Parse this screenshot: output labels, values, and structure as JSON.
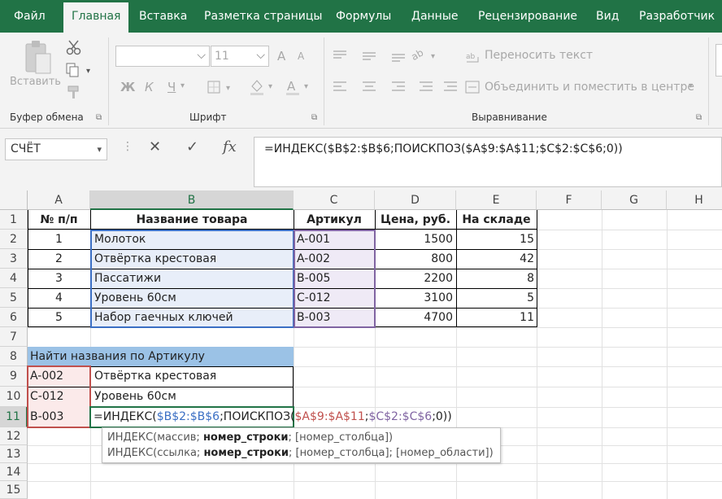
{
  "ribbon_tabs": [
    "Файл",
    "Главная",
    "Вставка",
    "Разметка страницы",
    "Формулы",
    "Данные",
    "Рецензирование",
    "Вид",
    "Разработчик"
  ],
  "active_tab": "Главная",
  "clipboard": {
    "paste_label": "Вставить",
    "group_label": "Буфер обмена"
  },
  "font": {
    "font_name": "",
    "font_size": "11",
    "group_label": "Шрифт",
    "bold": "Ж",
    "italic": "К",
    "underline": "Ч",
    "grow": "A",
    "shrink": "A"
  },
  "alignment": {
    "wrap_text": "Переносить текст",
    "merge_center": "Объединить и поместить в центре",
    "group_label": "Выравнивание"
  },
  "formula_bar": {
    "name_box": "СЧЁТ",
    "fx": "fx",
    "formula": "=ИНДЕКС($B$2:$B$6;ПОИСКПОЗ($A$9:$A$11;$C$2:$C$6;0))"
  },
  "columns": [
    "A",
    "B",
    "C",
    "D",
    "E",
    "F",
    "G",
    "H"
  ],
  "rows": [
    "1",
    "2",
    "3",
    "4",
    "5",
    "6",
    "7",
    "8",
    "9",
    "10",
    "11",
    "12",
    "13",
    "14",
    "15"
  ],
  "header_row": {
    "num": "№ п/п",
    "name": "Название товара",
    "article": "Артикул",
    "price": "Цена, руб.",
    "stock": "На складе"
  },
  "products": [
    {
      "num": "1",
      "name": "Молоток",
      "article": "A-001",
      "price": "1500",
      "stock": "15"
    },
    {
      "num": "2",
      "name": "Отвёртка крестовая",
      "article": "A-002",
      "price": "800",
      "stock": "42"
    },
    {
      "num": "3",
      "name": "Пассатижи",
      "article": "B-005",
      "price": "2200",
      "stock": "8"
    },
    {
      "num": "4",
      "name": "Уровень 60см",
      "article": "C-012",
      "price": "3100",
      "stock": "5"
    },
    {
      "num": "5",
      "name": "Набор гаечных ключей",
      "article": "B-003",
      "price": "4700",
      "stock": "11"
    }
  ],
  "lookup": {
    "title": "Найти названия по Артикулу",
    "rows": [
      {
        "article": "A-002",
        "result": "Отвёртка крестовая"
      },
      {
        "article": "C-012",
        "result": "Уровень 60см"
      }
    ],
    "edit_article": "B-003",
    "edit_formula_parts": {
      "p1": "=ИНДЕКС(",
      "p2": "$B$2:$B$6",
      "p3": ";ПОИСКПОЗ(",
      "p4": "$A$9:$A$11",
      "p5": ";",
      "p6": "$C$2:$C$6",
      "p7": ";0))"
    }
  },
  "tooltip": {
    "line1_a": "ИНДЕКС(массив; ",
    "line1_b": "номер_строки",
    "line1_c": "; [номер_столбца])",
    "line2_a": "ИНДЕКС(ссылка; ",
    "line2_b": "номер_строки",
    "line2_c": "; [номер_столбца]; [номер_области])"
  },
  "colors": {
    "brand_green": "#217346",
    "range_blue": "#3b6fc4",
    "range_red": "#c0504d",
    "range_purple": "#8064a2",
    "lookup_header_fill": "#9bc2e6"
  }
}
